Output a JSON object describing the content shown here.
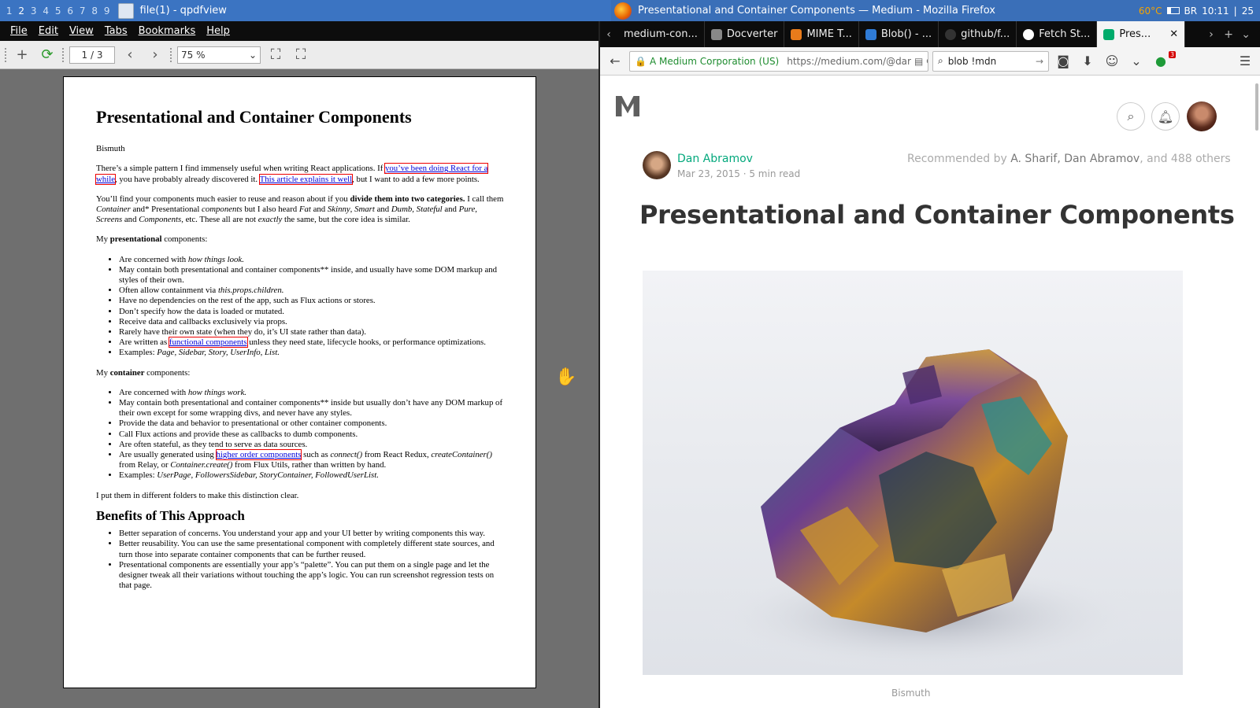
{
  "left_titlebar": {
    "workspaces": [
      "1",
      "2",
      "3",
      "4",
      "5",
      "6",
      "7",
      "8",
      "9"
    ],
    "title": "file(1) - qpdfview"
  },
  "right_titlebar": {
    "title": "Presentational and Container Components — Medium - Mozilla Firefox",
    "temp": "60°C",
    "battery_kbd": "BR",
    "time": "10:11",
    "extra": "25"
  },
  "qpdfview": {
    "menu": [
      "File",
      "Edit",
      "View",
      "Tabs",
      "Bookmarks",
      "Help"
    ],
    "page_field": "1 / 3",
    "zoom": "75 %",
    "doc": {
      "title": "Presentational and Container Components",
      "author": "Bismuth",
      "p1_a": "There’s a simple pattern I find immensely useful when writing React applications. If ",
      "p1_link1": "you’ve been doing React for a while",
      "p1_b": ", you have probably already discovered it. ",
      "p1_link2": "This article explains it well",
      "p1_c": ", but I want to add a few more points.",
      "p2_a": "You’ll find your components much easier to reuse and reason about if you ",
      "p2_bold": "divide them into two categories.",
      "p2_b": " I call them ",
      "p2_i1": "Container",
      "p2_c": " and* Presentational ",
      "p2_i2": "components",
      "p2_d": " but I also heard ",
      "p2_i3": "Fat",
      "p2_e": " and ",
      "p2_i4": "Skinny",
      "p2_f": ", ",
      "p2_i5": "Smart",
      "p2_g": " and ",
      "p2_i6": "Dumb, Stateful",
      "p2_h": " and ",
      "p2_i7": "Pure",
      "p2_i": ", ",
      "p2_i8": "Screens",
      "p2_j": " and ",
      "p2_i9": "Components",
      "p2_k": ", etc. These all are not ",
      "p2_i10": "exactly",
      "p2_l": " the same, but the core idea is similar.",
      "p3_a": "My ",
      "p3_bold": "presentational",
      "p3_b": " components:",
      "pres_1_a": "Are concerned with ",
      "pres_1_i": "how things look.",
      "pres_2": "May contain both presentational and container components** inside, and usually have some DOM markup and styles of their own.",
      "pres_3_a": "Often allow containment via ",
      "pres_3_i": "this.props.children.",
      "pres_4": "Have no dependencies on the rest of the app, such as Flux actions or stores.",
      "pres_5": "Don’t specify how the data is loaded or mutated.",
      "pres_6": "Receive data and callbacks exclusively via props.",
      "pres_7": "Rarely have their own state (when they do, it’s UI state rather than data).",
      "pres_8_a": "Are written as ",
      "pres_8_link": "functional components",
      "pres_8_b": " unless they need state, lifecycle hooks, or performance optimizations.",
      "pres_9_a": "Examples: ",
      "pres_9_i": "Page, Sidebar, Story, UserInfo, List.",
      "p4_a": "My ",
      "p4_bold": "container",
      "p4_b": " components:",
      "cont_1_a": "Are concerned with ",
      "cont_1_i": "how things work.",
      "cont_2": "May contain both presentational and container components** inside but usually don’t have any DOM markup of their own except for some wrapping divs, and never have any styles.",
      "cont_3": "Provide the data and behavior to presentational or other container components.",
      "cont_4": "Call Flux actions and provide these as callbacks to dumb components.",
      "cont_5": "Are often stateful, as they tend to serve as data sources.",
      "cont_6_a": "Are usually generated using ",
      "cont_6_link": "higher order components",
      "cont_6_b": " such as ",
      "cont_6_i1": "connect()",
      "cont_6_c": " from React Redux, ",
      "cont_6_i2": "createContainer()",
      "cont_6_d": " from Relay, or ",
      "cont_6_i3": "Container.create()",
      "cont_6_e": " from Flux Utils, rather than written by hand.",
      "cont_7_a": "Examples: ",
      "cont_7_i": "UserPage, FollowersSidebar, StoryContainer, FollowedUserList.",
      "p5": "I put them in different folders to make this distinction clear.",
      "h2": "Benefits of This Approach",
      "ben_1": "Better separation of concerns. You understand your app and your UI better by writing components this way.",
      "ben_2": "Better reusability. You can use the same presentational component with completely different state sources, and turn those into separate container components that can be further reused.",
      "ben_3": "Presentational components are essentially your app’s “palette”. You can put them on a single page and let the designer tweak all their variations without touching the app’s logic. You can run screenshot regression tests on that page."
    }
  },
  "firefox": {
    "tabs": [
      "medium-con...",
      "Docverter",
      "MIME T...",
      "Blob() - ...",
      "github/f...",
      "Fetch St...",
      "Pres..."
    ],
    "tab_close": "✕",
    "identity": "A Medium Corporation (US)",
    "url": "https://medium.com/@dar",
    "search": "blob !mdn",
    "addon_badge": "3",
    "article": {
      "author": "Dan Abramov",
      "date": "Mar 23, 2015",
      "read": "5 min read",
      "rec_prefix": "Recommended by ",
      "rec_names": "A. Sharif, Dan Abramov",
      "rec_suffix": ", and 488 others",
      "title": "Presentational and Container Components",
      "caption": "Bismuth"
    }
  }
}
